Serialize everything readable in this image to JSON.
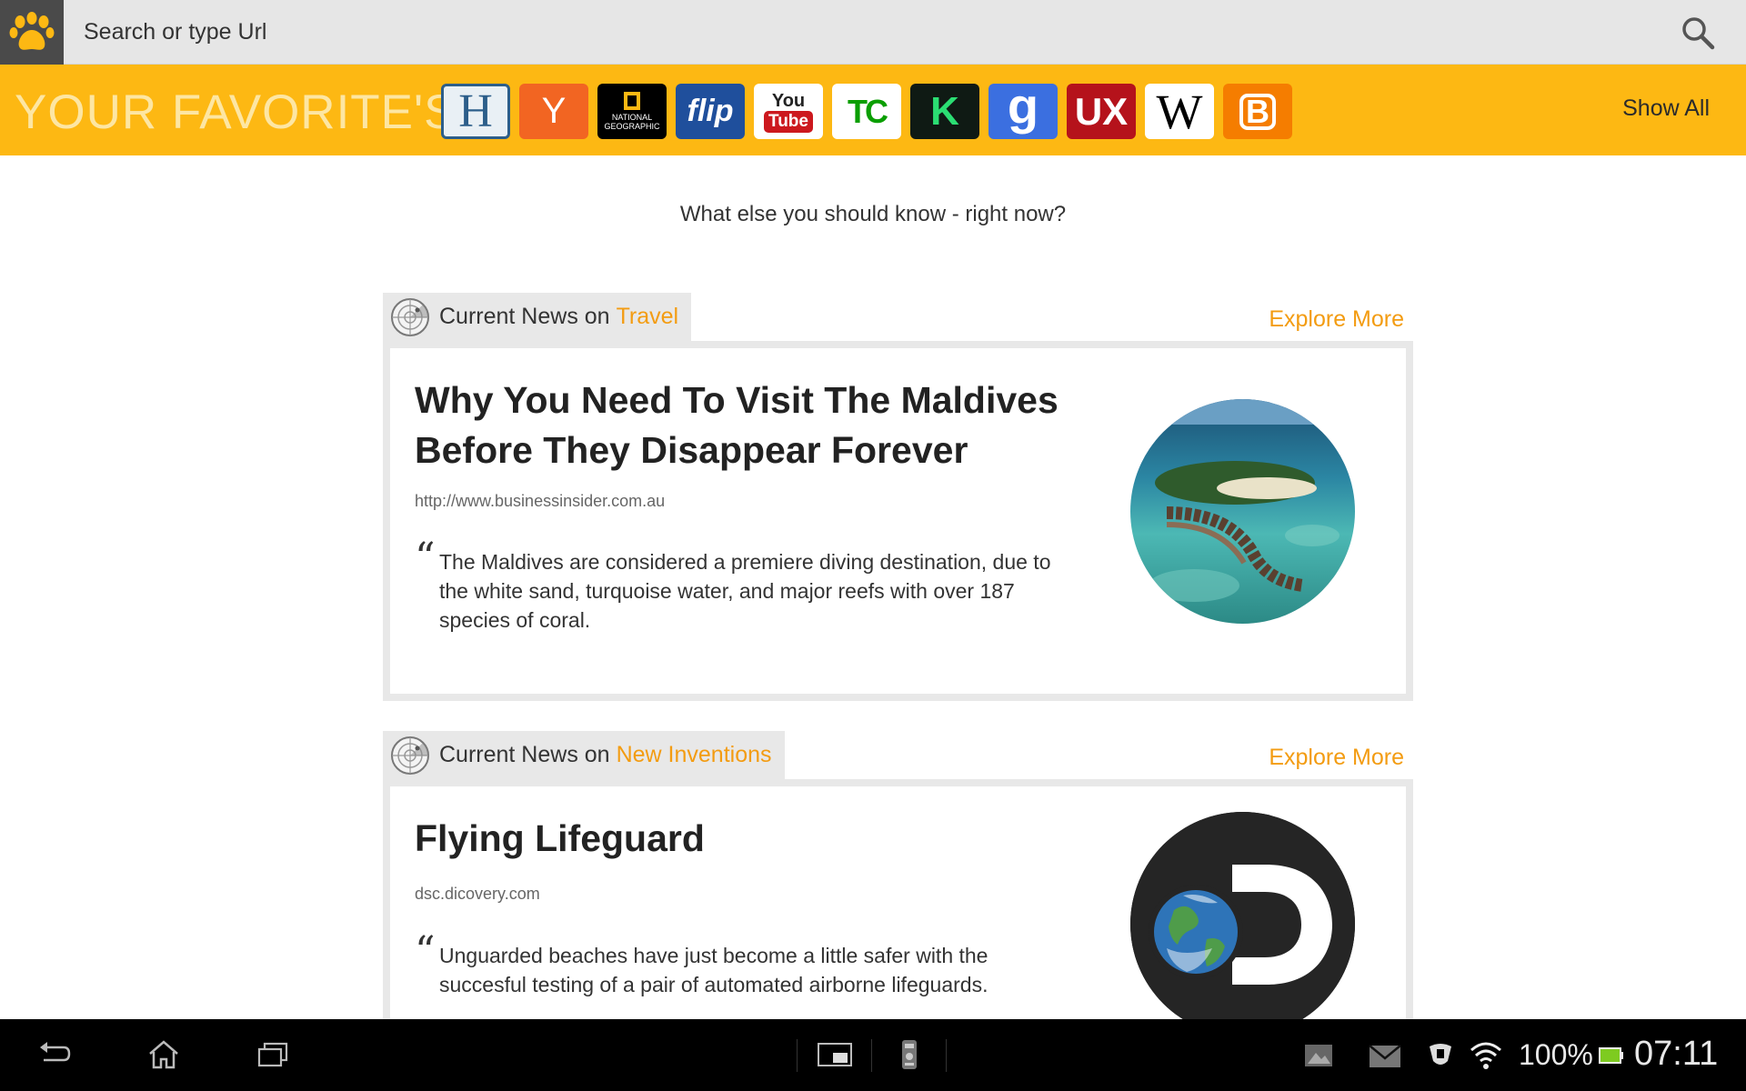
{
  "search": {
    "placeholder": "Search or type Url"
  },
  "favorites": {
    "title": "YOUR FAVORITE'S",
    "show_all": "Show All",
    "icons": [
      {
        "name": "huffington-post-icon",
        "letter": "H"
      },
      {
        "name": "hacker-news-icon",
        "letter": "Y"
      },
      {
        "name": "national-geographic-icon",
        "line1": "NATIONAL",
        "line2": "GEOGRAPHIC"
      },
      {
        "name": "flipkart-icon",
        "letter": "flip"
      },
      {
        "name": "youtube-icon",
        "line1": "You",
        "line2": "Tube"
      },
      {
        "name": "techcrunch-icon",
        "letter": "TC"
      },
      {
        "name": "kickstarter-icon",
        "letter": "K"
      },
      {
        "name": "google-icon",
        "letter": "g"
      },
      {
        "name": "ux-icon",
        "letter": "UX"
      },
      {
        "name": "wikipedia-icon",
        "letter": "W"
      },
      {
        "name": "blogger-icon",
        "letter": "B"
      }
    ]
  },
  "headline": "What else you should know - right now?",
  "sections": [
    {
      "prefix": "Current News on",
      "topic": "Travel",
      "explore": "Explore More",
      "article": {
        "title": "Why You Need To Visit The Maldives Before They Disappear Forever",
        "url": "http://www.businessinsider.com.au",
        "quote": "The Maldives are considered a premiere diving destination, due to the white sand, turquoise water, and major reefs with over 187 species of coral."
      }
    },
    {
      "prefix": "Current News on",
      "topic": "New Inventions",
      "explore": "Explore More",
      "article": {
        "title": "Flying Lifeguard",
        "url": "dsc.dicovery.com",
        "quote": "Unguarded beaches have just become a little safer with the succesful testing of a pair of automated airborne lifeguards."
      }
    }
  ],
  "status": {
    "battery": "100%",
    "time": "07:11"
  },
  "colors": {
    "accent": "#f39c12",
    "favbar": "#fdb813"
  }
}
